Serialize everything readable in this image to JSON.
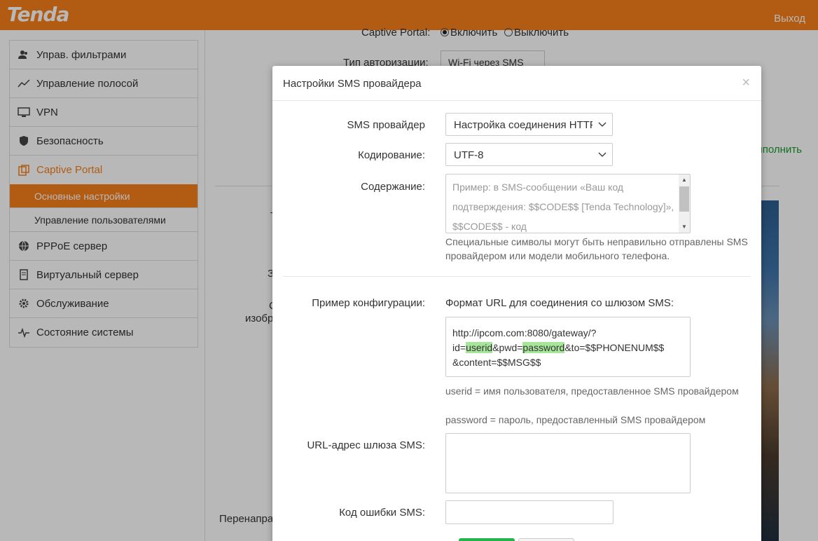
{
  "header": {
    "brand": "Tenda",
    "logout": "Выход"
  },
  "sidebar": {
    "items": [
      {
        "label": "Управ. фильтрами",
        "icon": "users-icon"
      },
      {
        "label": "Управление полосой",
        "icon": "bandwidth-icon"
      },
      {
        "label": "VPN",
        "icon": "vpn-icon"
      },
      {
        "label": "Безопасность",
        "icon": "shield-icon"
      },
      {
        "label": "Captive Portal",
        "icon": "portal-icon"
      }
    ],
    "subitems": [
      {
        "label": "Основные настройки"
      },
      {
        "label": "Управление пользователями"
      }
    ],
    "items2": [
      {
        "label": "PPPoE сервер",
        "icon": "globe-icon"
      },
      {
        "label": "Виртуальный сервер",
        "icon": "server-icon"
      },
      {
        "label": "Обслуживание",
        "icon": "gear-icon"
      },
      {
        "label": "Состояние системы",
        "icon": "pulse-icon"
      }
    ]
  },
  "background": {
    "captive_label": "Captive Portal:",
    "enable": "Включить",
    "disable": "Выключить",
    "auth_label": "Тип авторизации:",
    "auth_value": "Wi-Fi через SMS",
    "green_link": "лполнить",
    "fragment1": "Т",
    "fragment2": "З",
    "fragment3": "С",
    "fragment4": "изобр",
    "redirect_fragment": "Перенапра"
  },
  "modal": {
    "title": "Настройки SMS провайдера",
    "close": "×",
    "provider_label": "SMS провайдер",
    "provider_value": "Настройка соединения HTTP",
    "encoding_label": "Кодирование:",
    "encoding_value": "UTF-8",
    "content_label": "Содержание:",
    "content_placeholder": "Пример: в SMS-сообщении «Ваш код подтверждения: $$CODE$$ [Tenda Technology]», $$CODE$$ - код",
    "content_hint": "Специальные символы могут быть неправильно отправлены SMS провайдером или модели мобильного телефона.",
    "example_label": "Пример конфигурации:",
    "url_format_title": "Формат URL для соединения со шлюзом SMS:",
    "url_example": {
      "part1": "http://ipcom.com:8080/gateway/?",
      "part2": "id=",
      "userid": "userid",
      "part3": "&pwd=",
      "password": "password",
      "part4": "&to=$$PHONENUM$$",
      "part5": "&content=$$MSG$$"
    },
    "userid_hint": "userid = имя пользователя, предоставленное SMS провайдером",
    "password_hint": "password = пароль, предоставленный SMS провайдером",
    "gateway_label": "URL-адрес шлюза SMS:",
    "error_label": "Код ошибки SMS:"
  }
}
